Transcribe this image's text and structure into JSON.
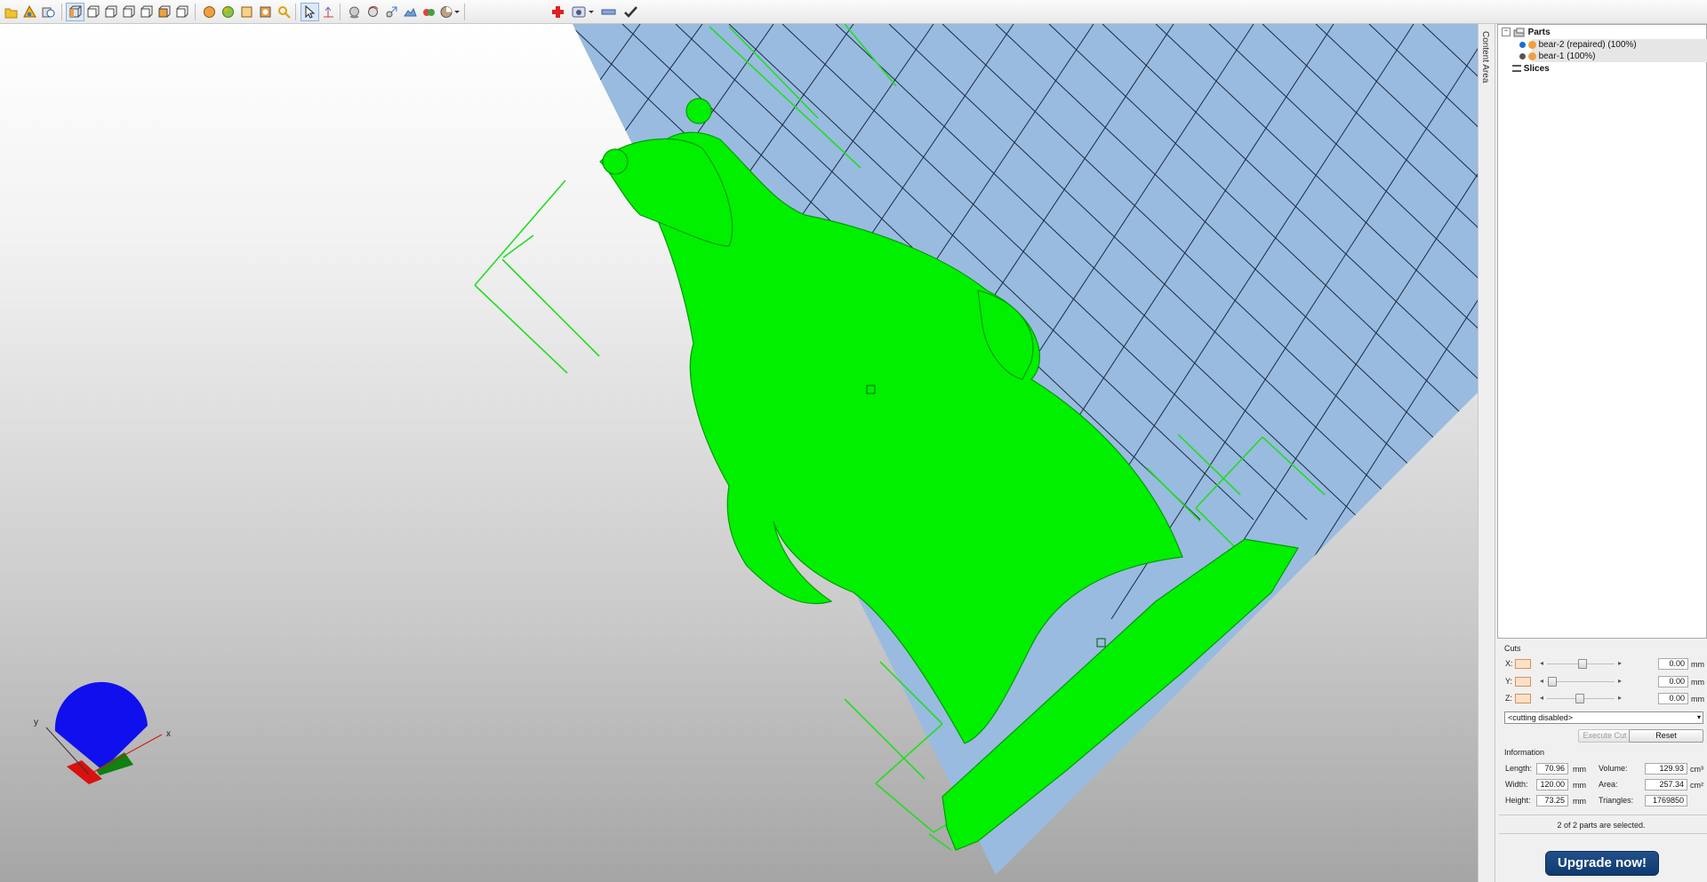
{
  "colors": {
    "model": "#00f000",
    "bed": "#99bbe0",
    "accent": "#0f3a6e"
  },
  "toolbar": {
    "icons": [
      "open-file-icon",
      "add-part-icon",
      "history-icon",
      "view-perspective-icon",
      "view-front-icon",
      "view-back-icon",
      "view-left-icon",
      "view-right-icon",
      "view-top-icon",
      "view-bottom-icon",
      "render-shaded-icon",
      "render-textured-icon",
      "render-wireframe-icon",
      "render-box-icon",
      "zoom-icon",
      "select-arrow-icon",
      "measure-icon",
      "sphere-icon",
      "rotate-icon",
      "scale-icon",
      "landscape-icon",
      "color-icon",
      "pie-menu-icon",
      "add-red-cross-icon",
      "gauge-icon",
      "rectangle-tool-icon",
      "checkmark-icon"
    ]
  },
  "sidebar": {
    "dock_label": "Content Area"
  },
  "tree": {
    "parts_label": "Parts",
    "items": [
      {
        "label": "bear-2 (repaired) (100%)"
      },
      {
        "label": "bear-1 (100%)"
      }
    ],
    "slices_label": "Slices"
  },
  "cuts": {
    "title": "Cuts",
    "rows": [
      {
        "axis": "X:",
        "value": "0.00",
        "unit": "mm",
        "pos": 0.55
      },
      {
        "axis": "Y:",
        "value": "0.00",
        "unit": "mm",
        "pos": 0.1
      },
      {
        "axis": "Z:",
        "value": "0.00",
        "unit": "mm",
        "pos": 0.52
      }
    ],
    "mode": "<cutting disabled>",
    "execute_label": "Execute Cut",
    "reset_label": "Reset"
  },
  "info": {
    "title": "Information",
    "length_label": "Length:",
    "length": "70.96",
    "length_unit": "mm",
    "width_label": "Width:",
    "width": "120.00",
    "width_unit": "mm",
    "height_label": "Height:",
    "height": "73.25",
    "height_unit": "mm",
    "volume_label": "Volume:",
    "volume": "129.93",
    "volume_unit": "cm³",
    "area_label": "Area:",
    "area": "257.34",
    "area_unit": "cm²",
    "triangles_label": "Triangles:",
    "triangles": "1769850",
    "status": "2 of 2 parts are selected."
  },
  "upgrade_label": "Upgrade now!",
  "axes": {
    "x": "x",
    "y": "y"
  }
}
